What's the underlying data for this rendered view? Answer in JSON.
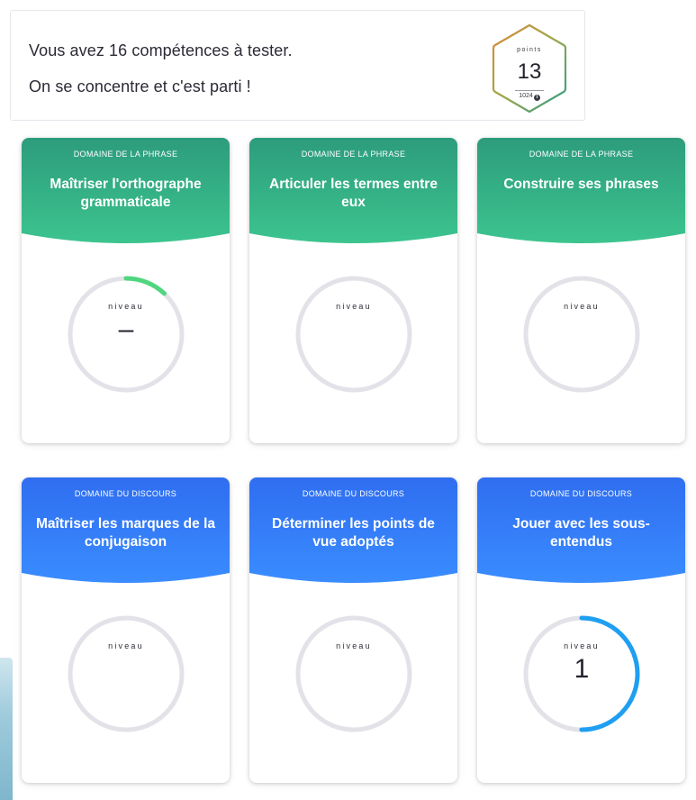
{
  "header": {
    "line1": "Vous avez 16 compétences à tester.",
    "line2": "On se concentre et c'est parti !",
    "points": {
      "label": "points",
      "value": "13",
      "total": "1024",
      "info_icon": "info-icon"
    }
  },
  "colors": {
    "phrase_top": "#2d9c7c",
    "phrase_bottom": "#3cc48f",
    "discours_top": "#2f6ef0",
    "discours_bottom": "#3a8cff",
    "gauge_track": "#e2e2e8",
    "gauge_green": "#4fd67e",
    "gauge_blue": "#1e9ff2"
  },
  "cards": [
    {
      "domain": "DOMAINE DE LA PHRASE",
      "title": "Maîtriser l'orthographe grammaticale",
      "gauge_label": "niveau",
      "value": "–",
      "progress": 0.12,
      "theme": "phrase"
    },
    {
      "domain": "DOMAINE DE LA PHRASE",
      "title": "Articuler les termes entre eux",
      "gauge_label": "niveau",
      "value": "",
      "progress": 0,
      "theme": "phrase"
    },
    {
      "domain": "DOMAINE DE LA PHRASE",
      "title": "Construire ses phrases",
      "gauge_label": "niveau",
      "value": "",
      "progress": 0,
      "theme": "phrase"
    },
    {
      "domain": "DOMAINE DU DISCOURS",
      "title": "Maîtriser les marques de la conjugaison",
      "gauge_label": "niveau",
      "value": "",
      "progress": 0,
      "theme": "discours"
    },
    {
      "domain": "DOMAINE DU DISCOURS",
      "title": "Déterminer les points de vue adoptés",
      "gauge_label": "niveau",
      "value": "",
      "progress": 0,
      "theme": "discours"
    },
    {
      "domain": "DOMAINE DU DISCOURS",
      "title": "Jouer avec les sous-entendus",
      "gauge_label": "niveau",
      "value": "1",
      "progress": 0.5,
      "theme": "discours"
    }
  ]
}
